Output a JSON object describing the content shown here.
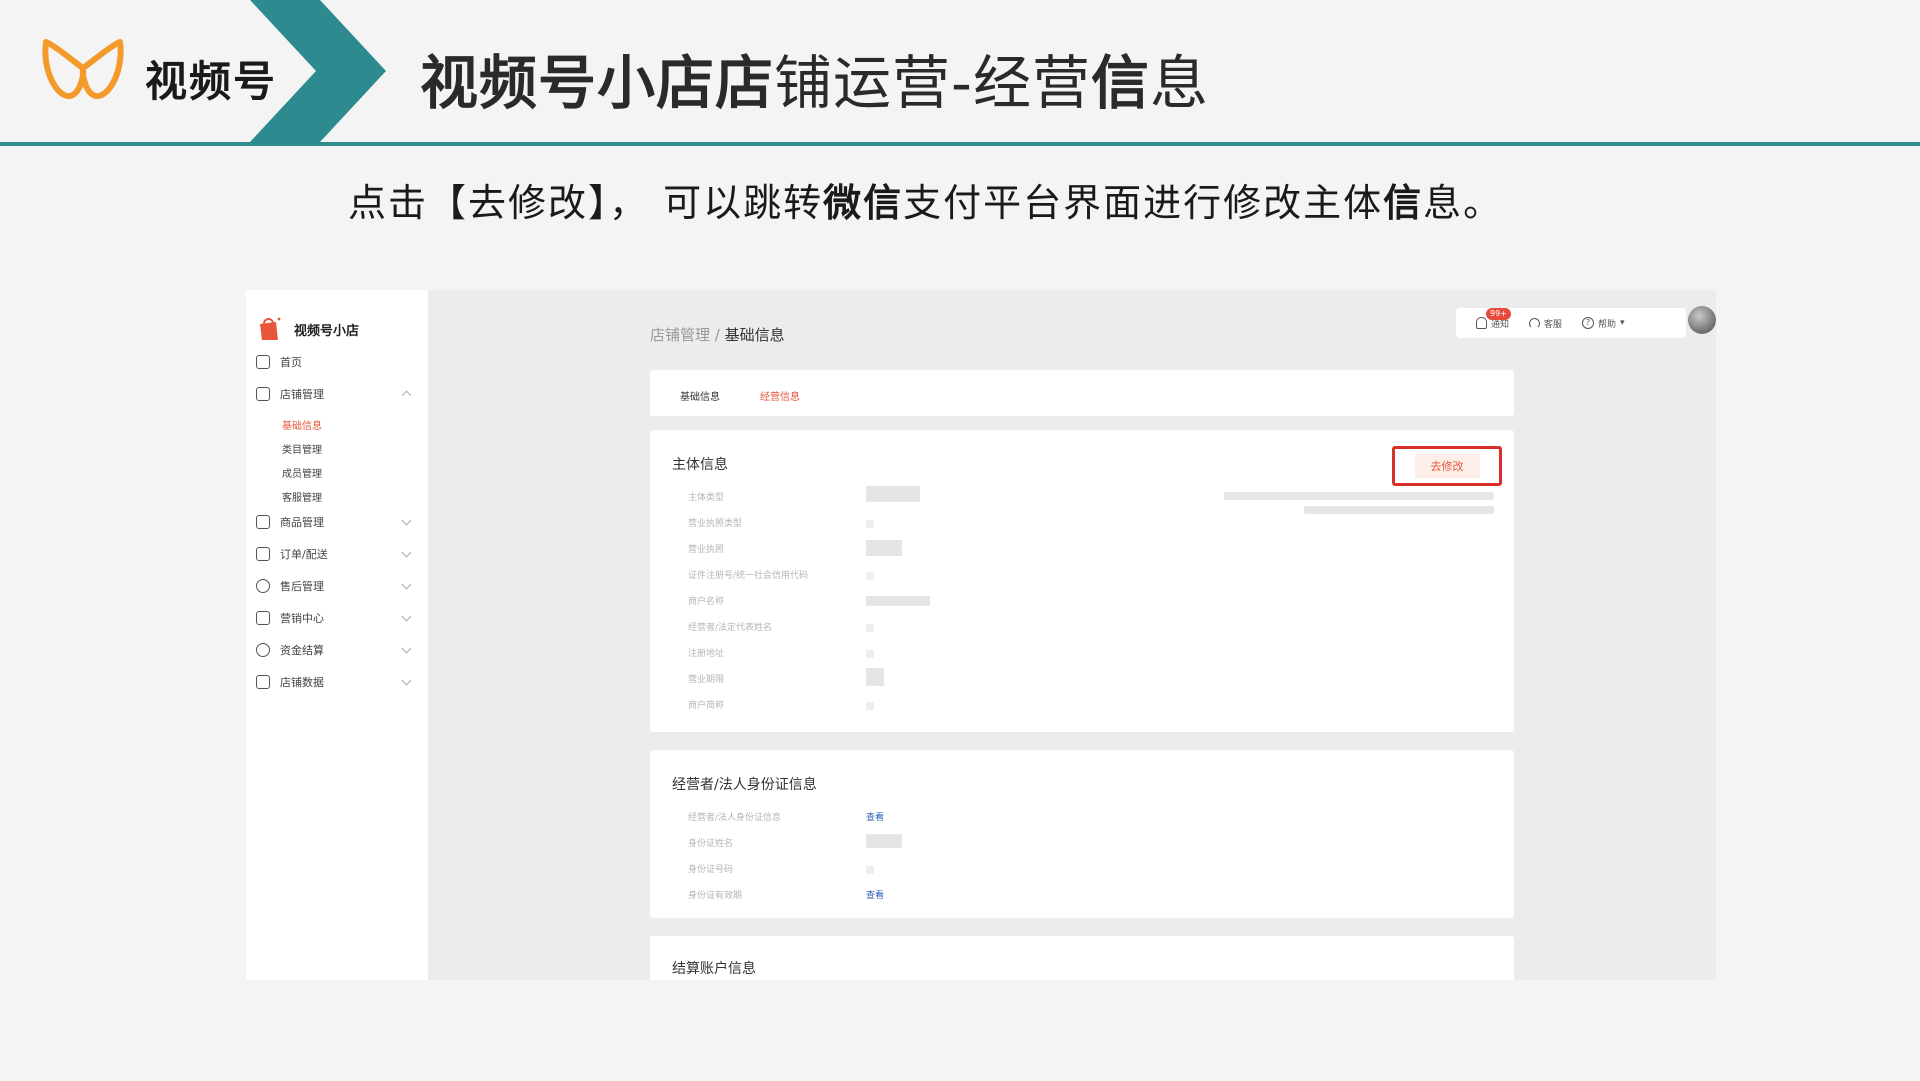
{
  "slide": {
    "brand": "视频号",
    "title_parts": [
      {
        "text": "视频号小店店",
        "bold": true
      },
      {
        "text": "铺运营-经营",
        "bold": false
      },
      {
        "text": "信",
        "bold": true
      },
      {
        "text": "息",
        "bold": false
      }
    ],
    "instruction_parts": [
      {
        "text": "点击【去修改】， 可以跳转",
        "bold": false
      },
      {
        "text": "微信",
        "bold": true
      },
      {
        "text": "支付平台界面进行修改主体",
        "bold": false
      },
      {
        "text": "信",
        "bold": true
      },
      {
        "text": "息。",
        "bold": false
      }
    ],
    "colors": {
      "accent": "#2d8a8f",
      "logo": "#f39a2b",
      "highlight": "#d9302c"
    }
  },
  "app": {
    "sidebar": {
      "title": "视频号小店",
      "items": [
        {
          "label": "首页",
          "icon": "home-icon"
        },
        {
          "label": "店铺管理",
          "icon": "store-icon",
          "expanded": true
        },
        {
          "label": "商品管理",
          "icon": "bag-icon"
        },
        {
          "label": "订单/配送",
          "icon": "order-icon"
        },
        {
          "label": "售后管理",
          "icon": "headset-icon"
        },
        {
          "label": "营销中心",
          "icon": "ticket-icon"
        },
        {
          "label": "资金结算",
          "icon": "coin-icon"
        },
        {
          "label": "店铺数据",
          "icon": "chart-icon"
        }
      ],
      "sub_items": [
        {
          "label": "基础信息",
          "active": true
        },
        {
          "label": "类目管理"
        },
        {
          "label": "成员管理"
        },
        {
          "label": "客服管理"
        }
      ]
    },
    "topbar": {
      "notice_badge": "99+",
      "notice": "通知",
      "service": "客服",
      "help": "帮助"
    },
    "breadcrumb": {
      "parent": "店铺管理 / ",
      "current": "基础信息"
    },
    "tabs": [
      {
        "label": "基础信息",
        "active": false
      },
      {
        "label": "经营信息",
        "active": true
      }
    ],
    "subject_card": {
      "title": "主体信息",
      "edit_button": "去修改",
      "fields": [
        "主体类型",
        "营业执照类型",
        "营业执照",
        "证件注册号/统一社会信用代码",
        "商户名称",
        "经营者/法定代表姓名",
        "注册地址",
        "营业期限",
        "商户简称"
      ]
    },
    "id_card": {
      "title": "经营者/法人身份证信息",
      "fields": [
        "经营者/法人身份证信息",
        "身份证姓名",
        "身份证号码",
        "身份证有效期"
      ],
      "view_link": "查看"
    },
    "settlement_card": {
      "title": "结算账户信息"
    }
  }
}
